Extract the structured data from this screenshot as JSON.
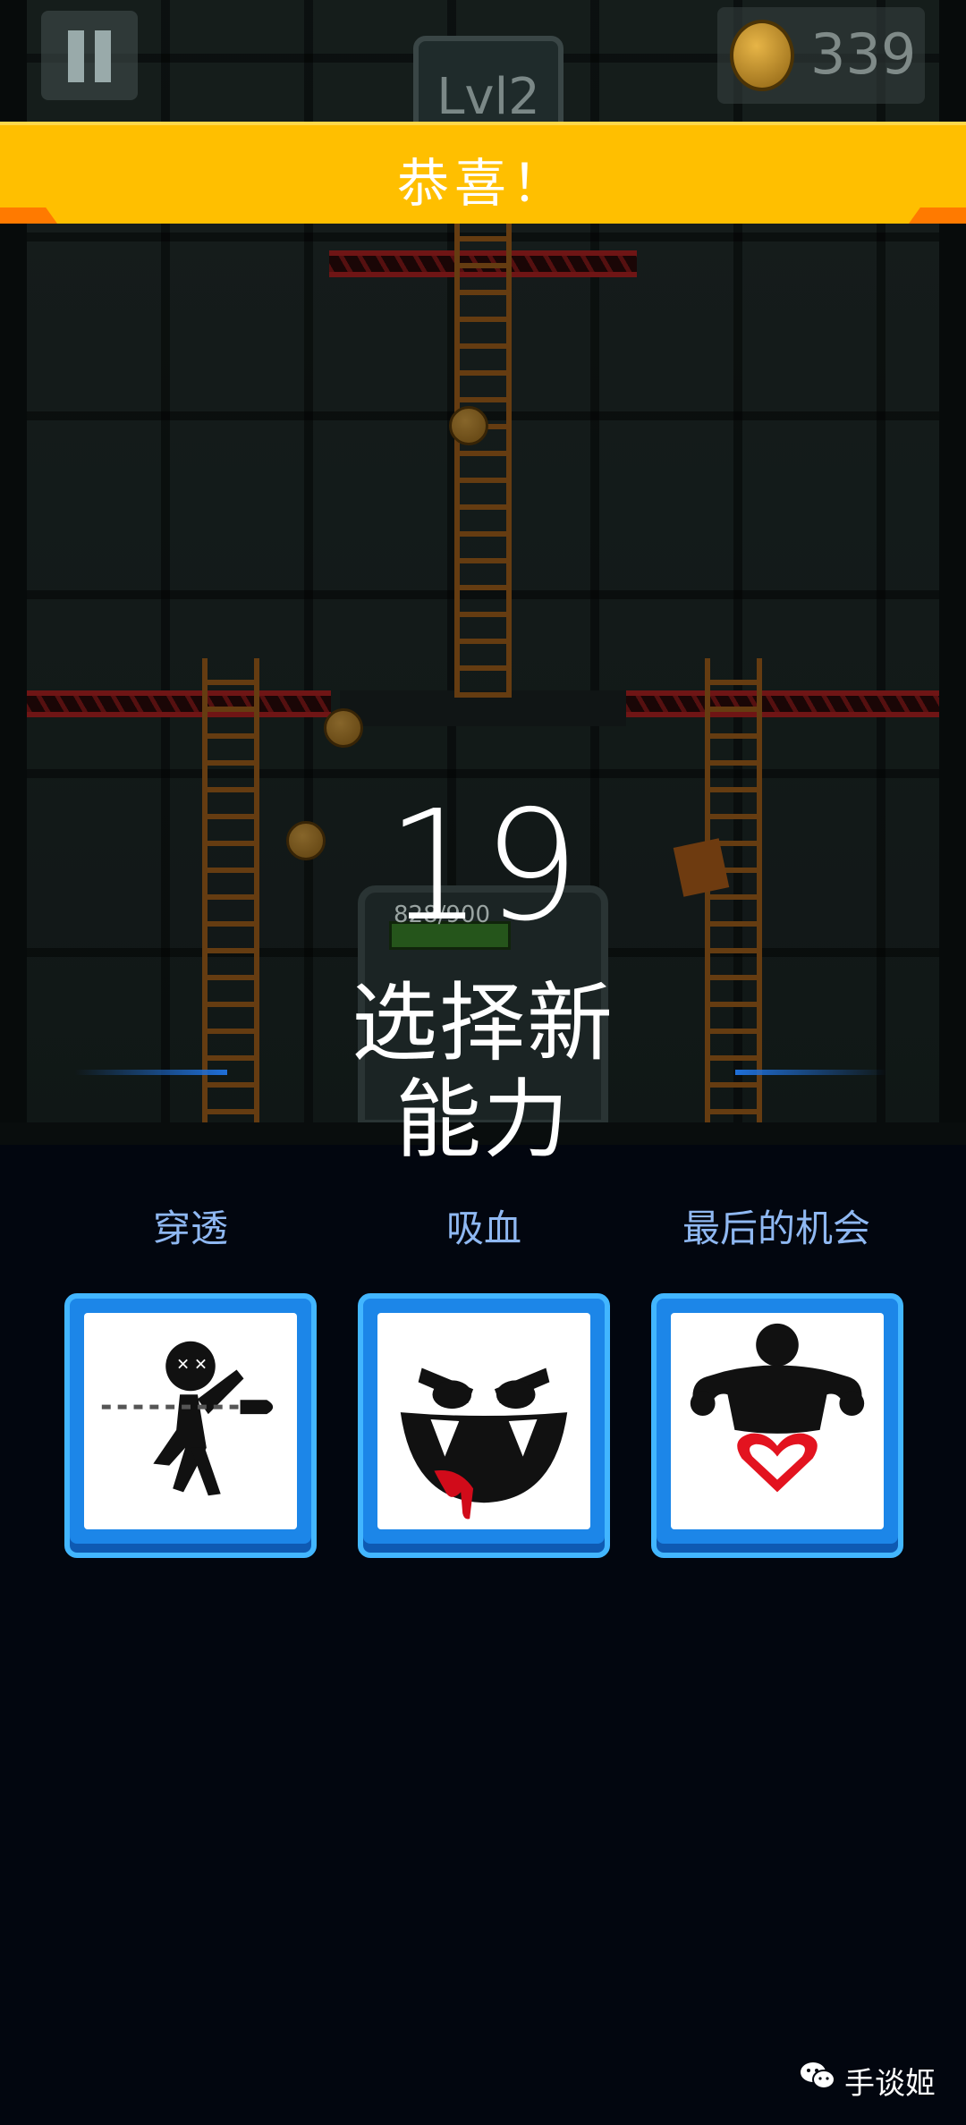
{
  "hud": {
    "coins": "339",
    "level": "Lvl2",
    "pause_icon": "pause-icon",
    "coin_icon": "coin-icon"
  },
  "banner": {
    "title": "恭喜！"
  },
  "overlay": {
    "countdown": "19",
    "boss_hp": "828/900",
    "prompt_line1": "选择新",
    "prompt_line2": "能力"
  },
  "abilities": [
    {
      "label": "穿透",
      "icon": "pierce-icon"
    },
    {
      "label": "吸血",
      "icon": "vampire-icon"
    },
    {
      "label": "最后的机会",
      "icon": "last-chance-icon"
    }
  ],
  "watermark": {
    "text": "手谈姬",
    "icon": "wechat-icon"
  },
  "colors": {
    "banner": "#ffbf00",
    "card_frame": "#1c86e8",
    "label_text": "#8fb8f2",
    "background": "#02060f"
  }
}
